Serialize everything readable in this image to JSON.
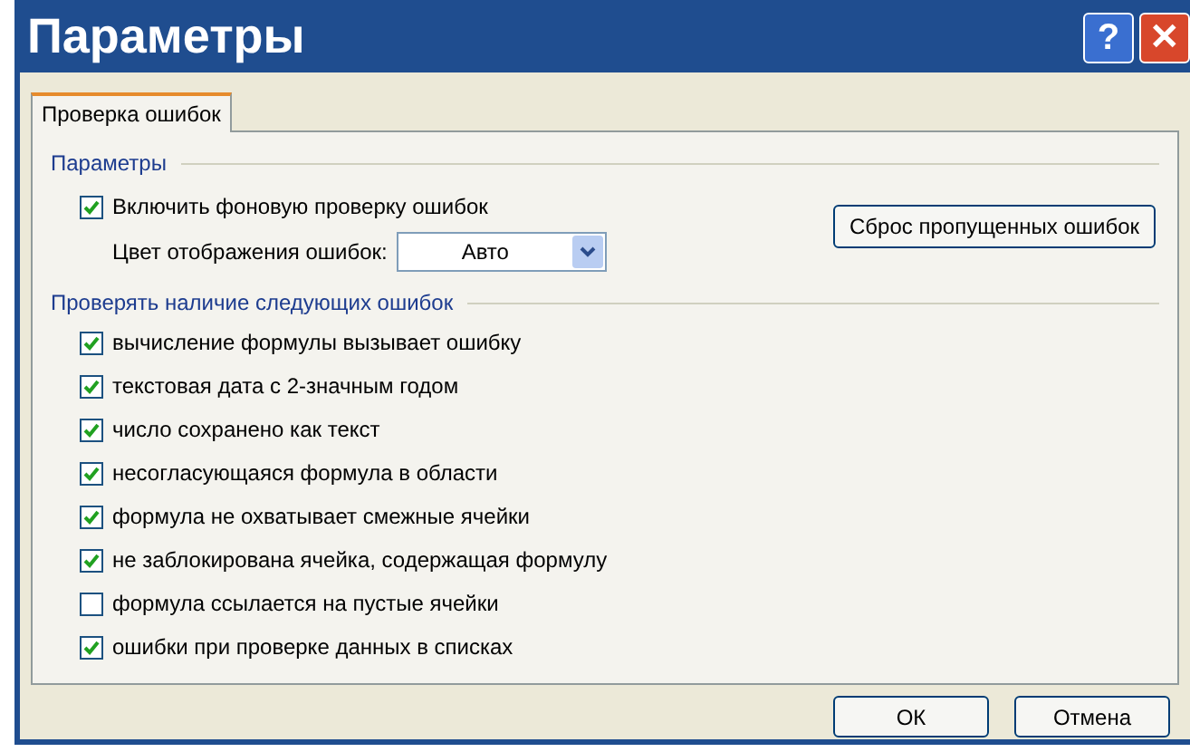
{
  "window": {
    "title": "Параметры",
    "buttons": [
      {
        "kind": "help",
        "label": "?"
      },
      {
        "kind": "close",
        "label": "✕"
      }
    ]
  },
  "tabs": [
    {
      "label": "Проверка ошибок",
      "selected": true
    }
  ],
  "settings": {
    "heading": "Параметры",
    "background_check": {
      "label": "Включить фоновую проверку ошибок",
      "checked": true
    },
    "color": {
      "label": "Цвет отображения ошибок:",
      "value": "Авто"
    },
    "reset_button": "Сброс пропущенных ошибок"
  },
  "rules": {
    "heading": "Проверять наличие следующих ошибок",
    "items": [
      {
        "label": "вычисление формулы вызывает ошибку",
        "checked": true
      },
      {
        "label": "текстовая дата с 2-значным годом",
        "checked": true
      },
      {
        "label": "число сохранено как текст",
        "checked": true
      },
      {
        "label": "несогласующаяся формула в области",
        "checked": true
      },
      {
        "label": "формула не охватывает смежные ячейки",
        "checked": true
      },
      {
        "label": "не заблокирована ячейка, содержащая формулу",
        "checked": true
      },
      {
        "label": "формула ссылается на пустые ячейки",
        "checked": false
      },
      {
        "label": "ошибки при проверке данных в списках",
        "checked": true
      }
    ]
  },
  "buttons": [
    "ОК",
    "Отмена"
  ]
}
